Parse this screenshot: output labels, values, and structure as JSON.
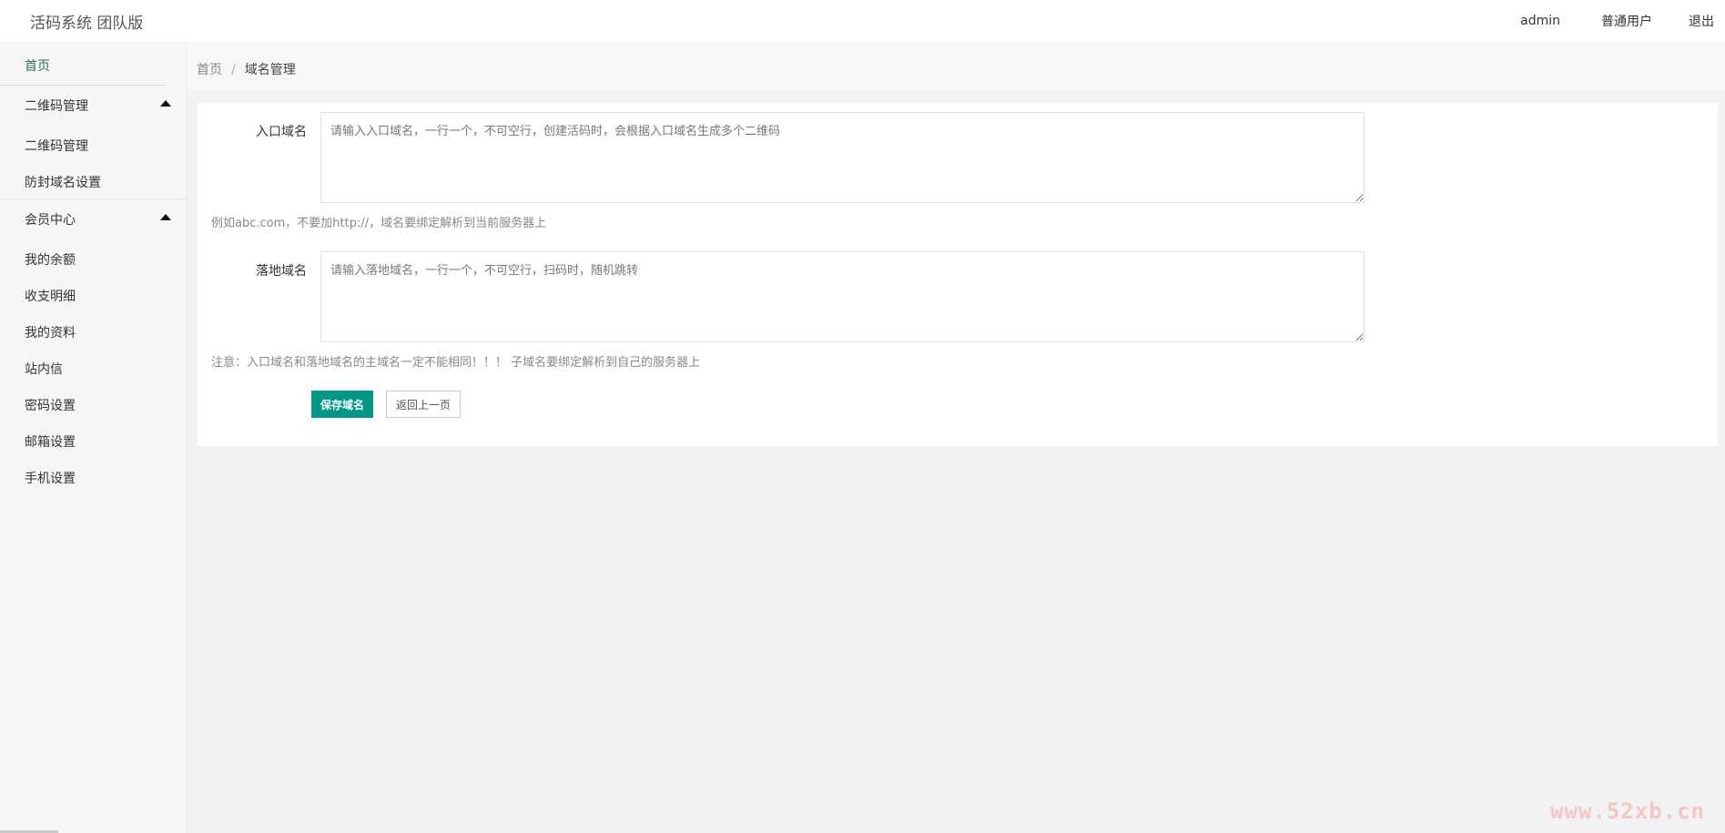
{
  "app": {
    "title": "活码系统 团队版"
  },
  "topnav": {
    "admin": "admin",
    "user_role": "普通用户",
    "logout": "退出"
  },
  "sidebar": {
    "home": "首页",
    "groups": [
      {
        "label": "二维码管理",
        "expanded": true,
        "items": [
          "二维码管理",
          "防封域名设置"
        ]
      },
      {
        "label": "会员中心",
        "expanded": true,
        "items": [
          "我的余额",
          "收支明细",
          "我的资料",
          "站内信",
          "密码设置",
          "邮箱设置",
          "手机设置"
        ]
      }
    ]
  },
  "breadcrumb": {
    "home": "首页",
    "separator": "/",
    "current": "域名管理"
  },
  "form": {
    "entry": {
      "label": "入口域名",
      "value": "",
      "placeholder": "请输入入口域名，一行一个，不可空行，创建活码时，会根据入口域名生成多个二维码",
      "hint": "例如abc.com，不要加http://，域名要绑定解析到当前服务器上"
    },
    "landing": {
      "label": "落地域名",
      "value": "",
      "placeholder": "请输入落地域名，一行一个，不可空行，扫码时，随机跳转",
      "hint": "注意：入口域名和落地域名的主域名一定不能相同！！！ 子域名要绑定解析到自己的服务器上"
    },
    "save_label": "保存域名",
    "back_label": "返回上一页"
  },
  "colors": {
    "primary": "#009688",
    "background": "#f2f2f2"
  },
  "watermark": "www.52xb.cn"
}
